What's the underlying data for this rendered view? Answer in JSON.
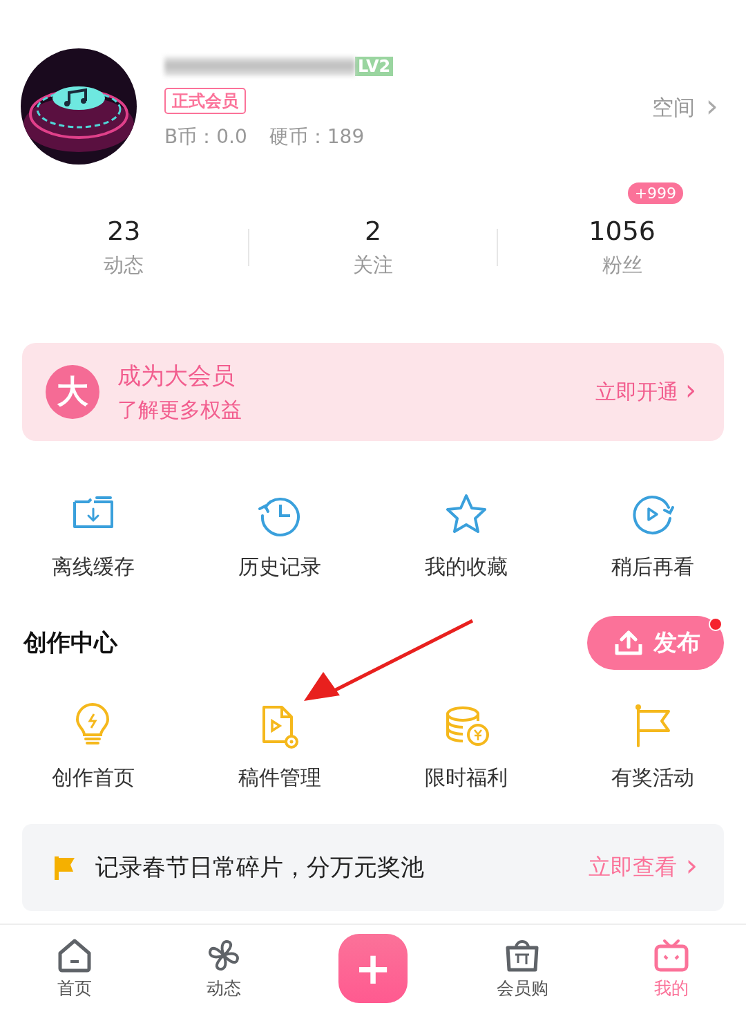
{
  "profile": {
    "level_badge": "LV2",
    "member_badge": "正式会员",
    "b_coins": "B币：0.0",
    "coins": "硬币：189",
    "space_link": "空间",
    "chevron": "›"
  },
  "stats": [
    {
      "value": "23",
      "label": "动态"
    },
    {
      "value": "2",
      "label": "关注"
    },
    {
      "value": "1056",
      "label": "粉丝",
      "badge": "+999"
    }
  ],
  "vip_banner": {
    "icon_text": "大",
    "title": "成为大会员",
    "subtitle": "了解更多权益",
    "action": "立即开通"
  },
  "quick_actions": [
    {
      "label": "离线缓存"
    },
    {
      "label": "历史记录"
    },
    {
      "label": "我的收藏"
    },
    {
      "label": "稍后再看"
    }
  ],
  "creator_center": {
    "title": "创作中心",
    "publish_button": "发布",
    "publish_dot": true,
    "items": [
      {
        "label": "创作首页"
      },
      {
        "label": "稿件管理"
      },
      {
        "label": "限时福利"
      },
      {
        "label": "有奖活动"
      }
    ]
  },
  "promo_banner": {
    "text": "记录春节日常碎片，分万元奖池",
    "action": "立即查看"
  },
  "bottom_nav": [
    {
      "kind": "tab",
      "label": "首页",
      "selected": false
    },
    {
      "kind": "tab",
      "label": "动态",
      "selected": false
    },
    {
      "kind": "plus",
      "label": "+"
    },
    {
      "kind": "tab",
      "label": "会员购",
      "selected": false
    },
    {
      "kind": "tab",
      "label": "我的",
      "selected": true
    }
  ]
}
